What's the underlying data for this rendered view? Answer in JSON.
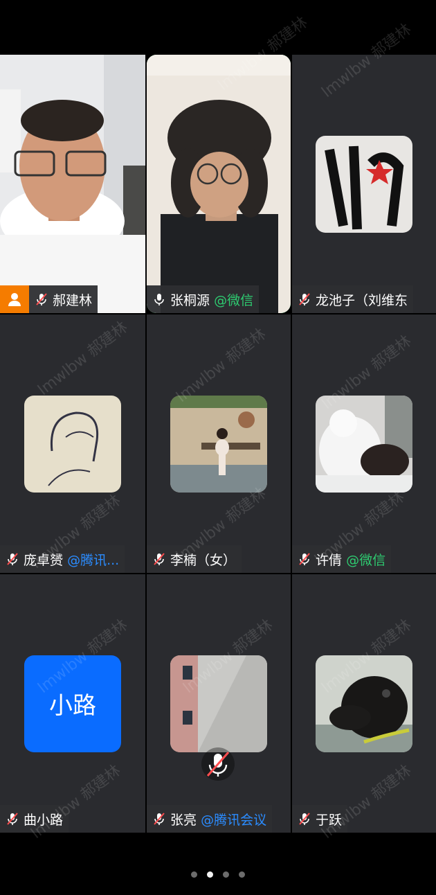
{
  "participants": [
    {
      "name": "郝建林",
      "tag": "",
      "tag_type": "",
      "muted": true,
      "host": true,
      "type": "video-man"
    },
    {
      "name": "张桐源",
      "tag": "@微信",
      "tag_type": "green",
      "muted": false,
      "host": false,
      "active": true,
      "type": "video-man2"
    },
    {
      "name": "龙池子（刘维东",
      "tag": "",
      "tag_type": "",
      "muted": true,
      "host": false,
      "type": "avatar-calligraphy"
    },
    {
      "name": "庞卓赟",
      "tag": "@腾讯...",
      "tag_type": "blue",
      "muted": true,
      "host": false,
      "type": "avatar-sketch"
    },
    {
      "name": "李楠（女）",
      "tag": "",
      "tag_type": "",
      "muted": true,
      "host": false,
      "type": "avatar-photo-woman"
    },
    {
      "name": "许倩",
      "tag": "@微信",
      "tag_type": "green",
      "muted": true,
      "host": false,
      "type": "avatar-cat"
    },
    {
      "name": "曲小路",
      "tag": "",
      "tag_type": "",
      "muted": true,
      "host": false,
      "type": "avatar-text",
      "avatar_text": "小路"
    },
    {
      "name": "张亮",
      "tag": "@腾讯会议",
      "tag_type": "blue",
      "muted": true,
      "host": false,
      "type": "avatar-building"
    },
    {
      "name": "于跃",
      "tag": "",
      "tag_type": "",
      "muted": true,
      "host": false,
      "type": "avatar-dog"
    }
  ],
  "watermark_text": "lmwlbw 郝建林",
  "page_indicator": {
    "count": 4,
    "current": 2
  },
  "colors": {
    "host": "#f57c00",
    "active_border": "#2ecc71",
    "tag_green": "#2ecc71",
    "tag_blue": "#2b8cff",
    "avatar_blue": "#0a6cff"
  },
  "icons": [
    "person-icon",
    "mic-icon",
    "mic-muted-icon"
  ]
}
